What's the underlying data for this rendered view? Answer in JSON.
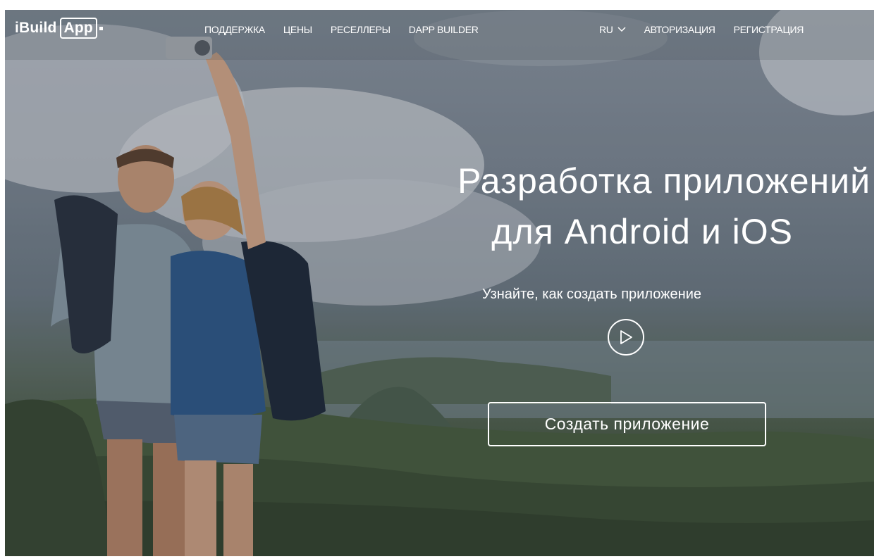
{
  "brand": {
    "logo_left": "iBuild",
    "logo_right": "App"
  },
  "nav": {
    "items": [
      "ПОДДЕРЖКА",
      "ЦЕНЫ",
      "РЕСЕЛЛЕРЫ",
      "DAPP BUILDER"
    ],
    "lang": "RU",
    "login": "АВТОРИЗАЦИЯ",
    "register": "РЕГИСТРАЦИЯ"
  },
  "hero": {
    "title_line1": "Разработка приложений",
    "title_line2": "для Android и iOS",
    "subtitle": "Узнайте, как создать приложение",
    "cta_label": "Создать приложение"
  },
  "icons": {
    "play": "play-icon",
    "lang_dropdown": "chevron-down-icon"
  },
  "colors": {
    "text": "#ffffff",
    "sky": "#7d8894",
    "land": "#4b5c45"
  }
}
